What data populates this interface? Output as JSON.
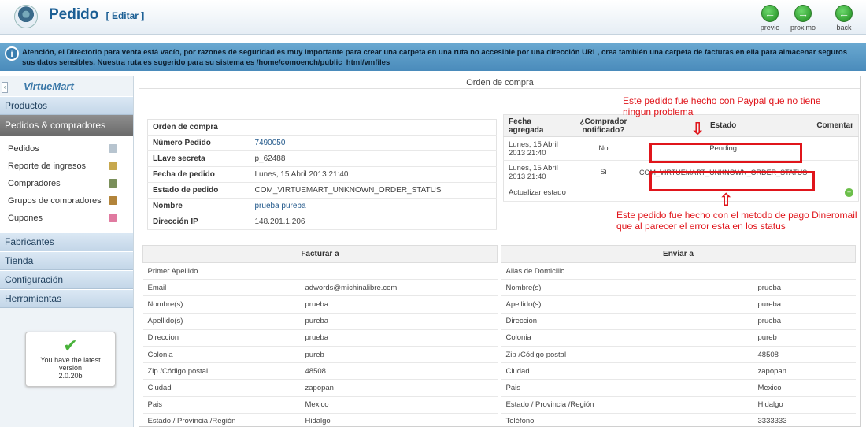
{
  "header": {
    "title": "Pedido",
    "edit_label": "[ Editar ]",
    "nav": [
      {
        "label": "previo",
        "symbol": "←"
      },
      {
        "label": "proximo",
        "symbol": "→"
      },
      {
        "label": "back",
        "symbol": "←"
      }
    ]
  },
  "notice": {
    "text": "Atención, el Directorio para venta está vacío, por razones de seguridad es muy importante para crear una carpeta en una ruta no accesible por una dirección URL, crea también una carpeta de facturas en ella para almacenar seguros sus datos sensibles. Nuestra ruta es sugerido para su sistema es /home/comoench/public_html/vmfiles"
  },
  "sidebar": {
    "logo": "VirtueMart",
    "products": "Productos",
    "orders": "Pedidos & compradores",
    "items": [
      {
        "label": "Pedidos",
        "icon": "orders-icon",
        "color": "#b7c4cf"
      },
      {
        "label": "Reporte de ingresos",
        "icon": "report-icon",
        "color": "#c7a84e"
      },
      {
        "label": "Compradores",
        "icon": "buyers-icon",
        "color": "#7a8f5a"
      },
      {
        "label": "Grupos de compradores",
        "icon": "groups-icon",
        "color": "#b2843a"
      },
      {
        "label": "Cupones",
        "icon": "coupon-icon",
        "color": "#e07aa0"
      }
    ],
    "bottom": [
      "Fabricantes",
      "Tienda",
      "Configuración",
      "Herramientas"
    ],
    "version": {
      "line1": "You have the latest",
      "line2": "version",
      "number": "2.0.20b"
    }
  },
  "main": {
    "title": "Orden de compra",
    "order": {
      "heading": "Orden de compra",
      "rows": [
        {
          "k": "Número Pedido",
          "v": "7490050"
        },
        {
          "k": "LLave secreta",
          "v": "p_62488"
        },
        {
          "k": "Fecha de pedido",
          "v": "Lunes, 15 Abril 2013 21:40"
        },
        {
          "k": "Estado de pedido",
          "v": "COM_VIRTUEMART_UNKNOWN_ORDER_STATUS"
        },
        {
          "k": "Nombre",
          "v": "prueba pureba"
        },
        {
          "k": "Dirección IP",
          "v": "148.201.1.206"
        }
      ]
    },
    "status": {
      "headers": [
        "Fecha agregada",
        "¿Comprador notificado?",
        "Estado",
        "Comentar"
      ],
      "rows": [
        {
          "date": "Lunes, 15 Abril 2013 21:40",
          "notified": "No",
          "state": "Pending",
          "comment": ""
        },
        {
          "date": "Lunes, 15 Abril 2013 21:40",
          "notified": "Si",
          "state": "COM_VIRTUEMART_UNKNOWN_ORDER_STATUS",
          "comment": ""
        }
      ],
      "update_label": "Actualizar estado"
    },
    "annotations": {
      "top": "Este pedido fue hecho con Paypal que no tiene ningun problema",
      "bottom": "Este pedido fue hecho con el metodo de pago Dineromail que al parecer el error esta en los status"
    },
    "billing": {
      "heading": "Facturar a",
      "rows": [
        {
          "k": "Primer Apellido",
          "v": ""
        },
        {
          "k": "Email",
          "v": "adwords@michinalibre.com"
        },
        {
          "k": "Nombre(s)",
          "v": "prueba"
        },
        {
          "k": "Apellido(s)",
          "v": "pureba"
        },
        {
          "k": "Direccion",
          "v": "prueba"
        },
        {
          "k": "Colonia",
          "v": "pureb"
        },
        {
          "k": "Zip /Código postal",
          "v": "48508"
        },
        {
          "k": "Ciudad",
          "v": "zapopan"
        },
        {
          "k": "Pais",
          "v": "Mexico"
        },
        {
          "k": "Estado / Provincia /Región",
          "v": "Hidalgo"
        }
      ]
    },
    "shipping": {
      "heading": "Enviar a",
      "rows": [
        {
          "k": "Alias de Domicilio",
          "v": ""
        },
        {
          "k": "Nombre(s)",
          "v": "prueba"
        },
        {
          "k": "Apellido(s)",
          "v": "pureba"
        },
        {
          "k": "Direccion",
          "v": "prueba"
        },
        {
          "k": "Colonia",
          "v": "pureb"
        },
        {
          "k": "Zip /Código postal",
          "v": "48508"
        },
        {
          "k": "Ciudad",
          "v": "zapopan"
        },
        {
          "k": "Pais",
          "v": "Mexico"
        },
        {
          "k": "Estado / Provincia /Región",
          "v": "Hidalgo"
        },
        {
          "k": "Teléfono",
          "v": "3333333"
        }
      ]
    }
  }
}
